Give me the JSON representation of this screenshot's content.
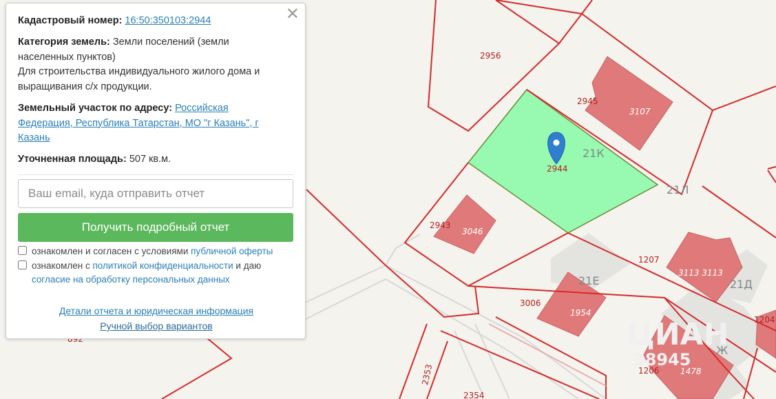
{
  "info": {
    "cadastral_label": "Кадастровый номер:",
    "cadastral_value": "16:50:350103:2944",
    "category_label": "Категория земель:",
    "category_line1": "Земли поселений (земли",
    "category_line2": "населенных пунктов)",
    "purpose_line1": "Для строительства индивидуального жилого дома и",
    "purpose_line2": "выращивания с/х продукции.",
    "address_label": "Земельный участок по адресу:",
    "address_line1": "Российская",
    "address_line2": "Федерация, Республика Татарстан, МО \"г Казань\", г",
    "address_line3": "Казань",
    "area_label": "Уточненная площадь:",
    "area_value": "507 кв.м."
  },
  "form": {
    "email_placeholder": "Ваш email, куда отправить отчет",
    "submit_label": "Получить подробный отчет",
    "consent1_text": "ознакомлен и согласен с условиями",
    "consent1_link": "публичной оферты",
    "consent2_text": "ознакомлен с",
    "consent2_link": "политикой конфиденциальности",
    "consent2_and": "и даю",
    "consent2_link2": "согласие на обработку персональных данных"
  },
  "footer": {
    "details_link": "Детали отчета и юридическая информация",
    "manual_link": "Ручной выбор вариантов"
  },
  "close_icon": "close-icon",
  "map": {
    "selected_parcel": "2944",
    "parcels": [
      "2956",
      "2945",
      "2943",
      "1207",
      "3006",
      "1204",
      "1206",
      "2353",
      "2354",
      "892"
    ],
    "buildings": [
      "3107",
      "3046",
      "3113 3113",
      "1954",
      "1478"
    ],
    "addresses": [
      "21К",
      "21Л",
      "21Е",
      "21Д",
      "Ж"
    ],
    "watermark": "ЦИАН",
    "watermark_id": "38945",
    "colors": {
      "selected_fill": "#97fab0",
      "boundary": "#d42a2a",
      "building": "#e07a7a",
      "marker": "#2f7fd0",
      "button": "#5cb85c"
    }
  }
}
